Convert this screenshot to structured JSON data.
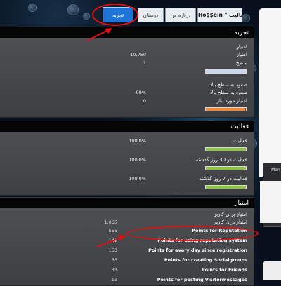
{
  "tabs": [
    {
      "label": "Ho$$ein \" فعالیت",
      "active": false
    },
    {
      "label": "درباره من",
      "active": false
    },
    {
      "label": "دوستان",
      "active": false
    },
    {
      "label": "تجربه",
      "active": true
    }
  ],
  "experience": {
    "title": "تجربه",
    "rows": [
      {
        "label": "امتیاز"
      },
      {
        "label": "امتیاز",
        "value": "10,750"
      },
      {
        "label": "سطح",
        "value": "1"
      }
    ],
    "level_bar_fill": 0,
    "level_up": {
      "heading": "صعود به سطح بالا",
      "label": "صعود به سطح بالا",
      "value": "99%",
      "needed_label": "امتیاز مورد نیاز",
      "needed_value": "0",
      "progress": 0.99
    }
  },
  "activity": {
    "title": "فعالیت",
    "rows": [
      {
        "label": "فعالیت",
        "value": "100.0%",
        "progress": 1.0
      },
      {
        "label": "فعالیت در 30 روز گذشته",
        "value": "100.0%",
        "progress": 1.0
      },
      {
        "label": "فعالیت در 7 روز گذشته",
        "value": "100.0%",
        "progress": 1.0
      }
    ]
  },
  "points": {
    "title": "امتیاز",
    "user_label": "امتیاز برای کاربر",
    "user_label2": "امتیاز برای کاربر",
    "user_value": "1,065",
    "rows": [
      {
        "label": "Points for Reputation",
        "value": "555"
      },
      {
        "label": "Points for using reputation system",
        "value": "142"
      },
      {
        "label": "Points for every day since registration",
        "value": "153"
      },
      {
        "label": "Points for creating Socialgroups",
        "value": "35"
      },
      {
        "label": "Points for Friends",
        "value": "33"
      },
      {
        "label": "Points for posting Visitormessages",
        "value": "13"
      }
    ]
  },
  "sidebar": {
    "label": "Mon"
  },
  "colors": {
    "active_tab": "#1f74d8",
    "level_bar": "#c8d8f0",
    "level_up_bar": "#f08a3a",
    "activity_bar": "#8cc63f",
    "annotation": "#e01010"
  }
}
